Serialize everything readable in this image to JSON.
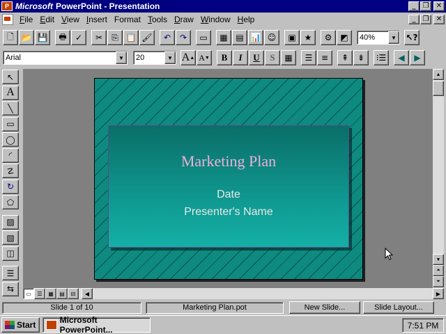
{
  "window": {
    "brand": "Microsoft",
    "title": "PowerPoint - Presentation"
  },
  "menu": {
    "items": [
      {
        "hotkey": "F",
        "rest": "ile"
      },
      {
        "hotkey": "E",
        "rest": "dit"
      },
      {
        "hotkey": "V",
        "rest": "iew"
      },
      {
        "hotkey": "I",
        "rest": "nsert"
      },
      {
        "hotkey": "F",
        "rest": "ormat",
        "label_prefix": "F"
      },
      {
        "hotkey": "T",
        "rest": "ools"
      },
      {
        "hotkey": "D",
        "rest": "raw"
      },
      {
        "hotkey": "W",
        "rest": "indow"
      },
      {
        "hotkey": "H",
        "rest": "elp"
      }
    ]
  },
  "toolbar": {
    "zoom_value": "40%"
  },
  "formatting": {
    "font_name": "Arial",
    "font_size": "20",
    "bold_label": "B",
    "italic_label": "I",
    "underline_label": "U",
    "shadow_label": "S"
  },
  "slide": {
    "title": "Marketing Plan",
    "date": "Date",
    "presenter": "Presenter's Name"
  },
  "status": {
    "slide_position": "Slide 1 of 10",
    "template": "Marketing Plan.pot",
    "new_slide_label": "New Slide...",
    "slide_layout_label": "Slide Layout..."
  },
  "taskbar": {
    "start_label": "Start",
    "task_label": "Microsoft PowerPoint...",
    "clock": "7:51 PM"
  },
  "colors": {
    "titlebar": "#000080",
    "slide_background": "#0e8a80",
    "slide_title": "#f0b0d8",
    "slide_text": "#e8e8e8"
  }
}
